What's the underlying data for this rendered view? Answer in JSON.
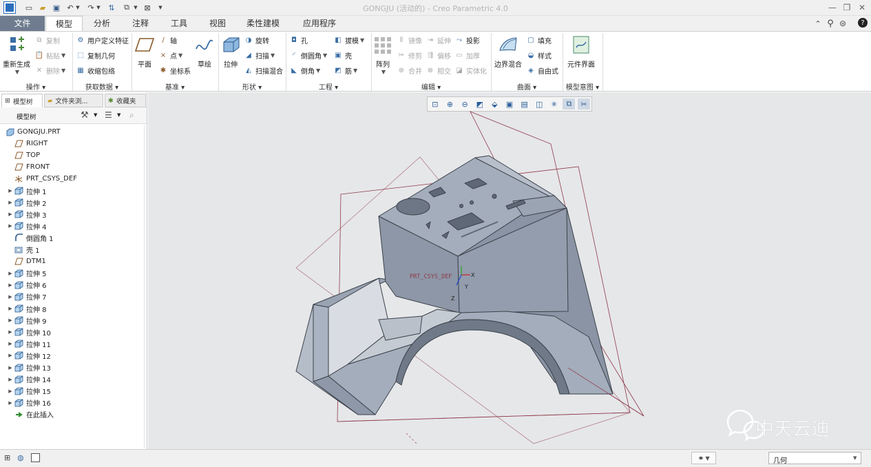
{
  "window": {
    "title": "GONGJU (活动的) - Creo Parametric 4.0"
  },
  "tabs": [
    "文件",
    "模型",
    "分析",
    "注释",
    "工具",
    "视图",
    "柔性建模",
    "应用程序"
  ],
  "ribbon": {
    "operations": {
      "regenerate": "重新生成",
      "copy": "复制",
      "paste": "粘贴",
      "delete": "删除",
      "label": "操作"
    },
    "get_data": {
      "udf": "用户定义特征",
      "copy_geom": "复制几何",
      "shrinkwrap": "收缩包络",
      "label": "获取数据"
    },
    "datum": {
      "plane": "平面",
      "axis": "轴",
      "point": "点",
      "csys": "坐标系",
      "sketch": "草绘",
      "label": "基准"
    },
    "shapes": {
      "extrude": "拉伸",
      "revolve": "旋转",
      "sweep": "扫描",
      "swept_blend": "扫描混合",
      "label": "形状"
    },
    "engineering": {
      "hole": "孔",
      "round": "倒圆角",
      "chamfer": "倒角",
      "draft": "拔模",
      "shell": "壳",
      "rib": "筋",
      "label": "工程"
    },
    "editing": {
      "pattern": "阵列",
      "mirror": "镜像",
      "extend": "延伸",
      "project": "投影",
      "trim": "修剪",
      "offset": "偏移",
      "thicken": "加厚",
      "merge": "合并",
      "intersect": "相交",
      "solidify": "实体化",
      "label": "编辑"
    },
    "surfaces": {
      "fill": "填充",
      "boundary_blend": "边界混合",
      "style": "样式",
      "freestyle": "自由式",
      "label": "曲面"
    },
    "model_intent": {
      "component_interface": "元件界面",
      "label": "模型意图"
    }
  },
  "panel": {
    "tabs": [
      "模型树",
      "文件夹浏...",
      "收藏夹"
    ],
    "tree_header": "模型树",
    "items": [
      {
        "label": "GONGJU.PRT",
        "icon": "part-icon",
        "expand": false,
        "indent": 0
      },
      {
        "label": "RIGHT",
        "icon": "datum-plane-icon",
        "expand": false,
        "indent": 1
      },
      {
        "label": "TOP",
        "icon": "datum-plane-icon",
        "expand": false,
        "indent": 1
      },
      {
        "label": "FRONT",
        "icon": "datum-plane-icon",
        "expand": false,
        "indent": 1
      },
      {
        "label": "PRT_CSYS_DEF",
        "icon": "csys-icon",
        "expand": false,
        "indent": 1
      },
      {
        "label": "拉伸 1",
        "icon": "extrude-icon",
        "expand": true,
        "indent": 1
      },
      {
        "label": "拉伸 2",
        "icon": "extrude-icon",
        "expand": true,
        "indent": 1
      },
      {
        "label": "拉伸 3",
        "icon": "extrude-icon",
        "expand": true,
        "indent": 1
      },
      {
        "label": "拉伸 4",
        "icon": "extrude-icon",
        "expand": true,
        "indent": 1
      },
      {
        "label": "倒圆角 1",
        "icon": "round-icon",
        "expand": false,
        "indent": 1
      },
      {
        "label": "壳 1",
        "icon": "shell-icon",
        "expand": false,
        "indent": 1
      },
      {
        "label": "DTM1",
        "icon": "datum-plane-icon",
        "expand": false,
        "indent": 1
      },
      {
        "label": "拉伸 5",
        "icon": "extrude-icon",
        "expand": true,
        "indent": 1
      },
      {
        "label": "拉伸 6",
        "icon": "extrude-icon",
        "expand": true,
        "indent": 1
      },
      {
        "label": "拉伸 7",
        "icon": "extrude-icon",
        "expand": true,
        "indent": 1
      },
      {
        "label": "拉伸 8",
        "icon": "extrude-icon",
        "expand": true,
        "indent": 1
      },
      {
        "label": "拉伸 9",
        "icon": "extrude-icon",
        "expand": true,
        "indent": 1
      },
      {
        "label": "拉伸 10",
        "icon": "extrude-icon",
        "expand": true,
        "indent": 1
      },
      {
        "label": "拉伸 11",
        "icon": "extrude-icon",
        "expand": true,
        "indent": 1
      },
      {
        "label": "拉伸 12",
        "icon": "extrude-icon",
        "expand": true,
        "indent": 1
      },
      {
        "label": "拉伸 13",
        "icon": "extrude-icon",
        "expand": true,
        "indent": 1
      },
      {
        "label": "拉伸 14",
        "icon": "extrude-icon",
        "expand": true,
        "indent": 1
      },
      {
        "label": "拉伸 15",
        "icon": "extrude-icon",
        "expand": true,
        "indent": 1
      },
      {
        "label": "拉伸 16",
        "icon": "extrude-icon",
        "expand": true,
        "indent": 1
      },
      {
        "label": "在此插入",
        "icon": "insert-arrow-icon",
        "expand": false,
        "indent": 1
      }
    ]
  },
  "viewport": {
    "csys_label": "PRT_CSYS_DEF",
    "axis_x": "X",
    "axis_y": "Y",
    "axis_z": "Z",
    "watermark": "中天云迪"
  },
  "status": {
    "filter_value": "几何"
  },
  "colors": {
    "file_tab": "#6f7c8f",
    "viewport_bg": "#e6e7e9",
    "model_face": "#8f9aaa",
    "datum_plane": "#8e3a4a"
  }
}
